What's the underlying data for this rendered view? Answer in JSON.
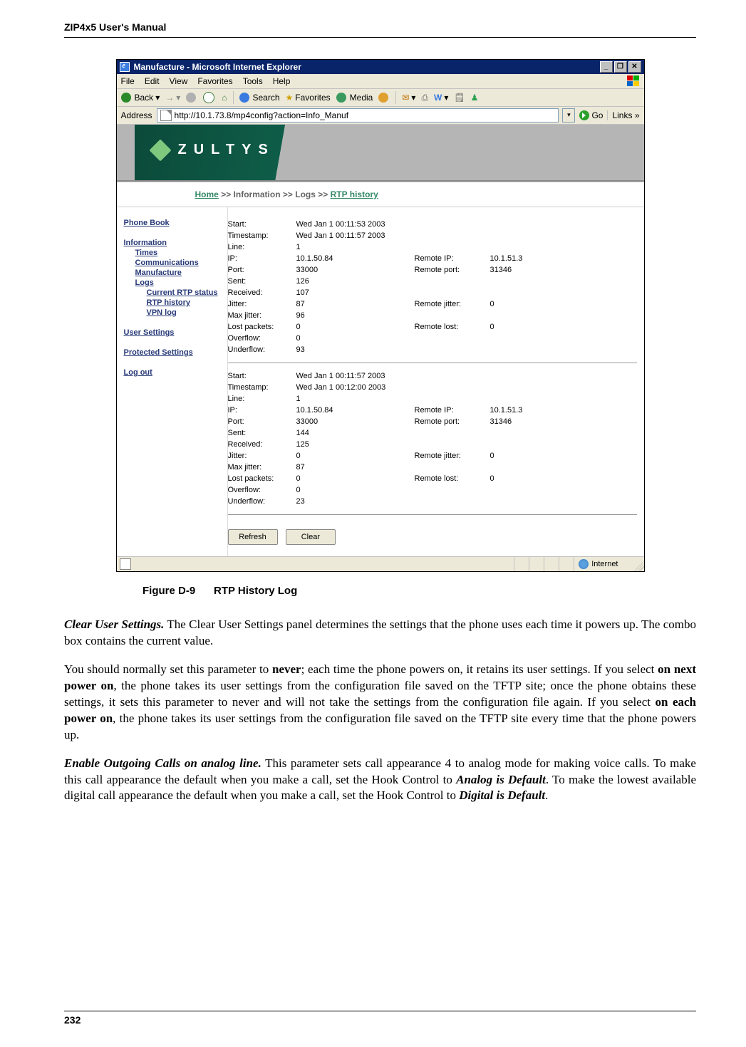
{
  "header_title": "ZIP4x5 User's Manual",
  "window": {
    "title": "Manufacture - Microsoft Internet Explorer",
    "menu": [
      "File",
      "Edit",
      "View",
      "Favorites",
      "Tools",
      "Help"
    ],
    "toolbar": {
      "back": "Back",
      "search": "Search",
      "favorites": "Favorites",
      "media": "Media"
    },
    "address_label": "Address",
    "url": "http://10.1.73.8/mp4config?action=Info_Manuf",
    "go_label": "Go",
    "links_label": "Links",
    "status_zone": "Internet"
  },
  "banner": {
    "brand": "ZULTYS"
  },
  "breadcrumb": {
    "home": "Home",
    "sep": ">>",
    "info": "Information",
    "logs": "Logs",
    "rtp": "RTP history"
  },
  "sidenav": {
    "phone_book": "Phone Book",
    "information": "Information",
    "times": "Times",
    "communications": "Communications",
    "manufacture": "Manufacture",
    "logs": "Logs",
    "current_rtp": "Current RTP status",
    "rtp_history": "RTP history",
    "vpn_log": "VPN log",
    "user_settings": "User Settings",
    "protected_settings": "Protected Settings",
    "log_out": "Log out"
  },
  "labels": {
    "start": "Start:",
    "timestamp": "Timestamp:",
    "line": "Line:",
    "ip": "IP:",
    "port": "Port:",
    "sent": "Sent:",
    "received": "Received:",
    "jitter": "Jitter:",
    "max_jitter": "Max jitter:",
    "lost_packets": "Lost packets:",
    "overflow": "Overflow:",
    "underflow": "Underflow:",
    "remote_ip": "Remote IP:",
    "remote_port": "Remote port:",
    "remote_jitter": "Remote jitter:",
    "remote_lost": "Remote lost:"
  },
  "records": [
    {
      "start": "Wed Jan 1 00:11:53 2003",
      "timestamp": "Wed Jan 1 00:11:57 2003",
      "line": "1",
      "ip": "10.1.50.84",
      "remote_ip": "10.1.51.3",
      "port": "33000",
      "remote_port": "31346",
      "sent": "126",
      "received": "107",
      "jitter": "87",
      "remote_jitter": "0",
      "max_jitter": "96",
      "lost": "0",
      "remote_lost": "0",
      "overflow": "0",
      "underflow": "93"
    },
    {
      "start": "Wed Jan 1 00:11:57 2003",
      "timestamp": "Wed Jan 1 00:12:00 2003",
      "line": "1",
      "ip": "10.1.50.84",
      "remote_ip": "10.1.51.3",
      "port": "33000",
      "remote_port": "31346",
      "sent": "144",
      "received": "125",
      "jitter": "0",
      "remote_jitter": "0",
      "max_jitter": "87",
      "lost": "0",
      "remote_lost": "0",
      "overflow": "0",
      "underflow": "23"
    }
  ],
  "buttons": {
    "refresh": "Refresh",
    "clear": "Clear"
  },
  "figure": {
    "no": "Figure D-9",
    "title": "RTP History Log"
  },
  "para1": {
    "lead": "Clear User Settings.",
    "rest": " The Clear User Settings panel determines the settings that the phone uses each time it powers up. The combo box contains the current value."
  },
  "para2": {
    "a": "You should normally set this parameter to ",
    "never": "never",
    "b": "; each time the phone powers on, it retains its user settings. If you select ",
    "next": "on next power on",
    "c": ", the phone takes its user settings from the configuration file saved on the TFTP site; once the phone obtains these settings, it sets this parameter to never and will not take the settings from the configuration file again. If you select ",
    "each": "on each power on",
    "d": ", the phone takes its user settings from the configuration file saved on the TFTP site every time that the phone powers up."
  },
  "para3": {
    "lead": "Enable Outgoing Calls on analog line.",
    "a": " This parameter sets call appearance 4 to analog mode for making voice calls. To make this call appearance the default when you make a call, set the Hook Control to ",
    "analog": "Analog is Default",
    "b": ". To make the lowest available digital call appearance the default when you make a call, set the Hook Control to ",
    "digital": "Digital is Default",
    "c": "."
  },
  "page_number": "232"
}
